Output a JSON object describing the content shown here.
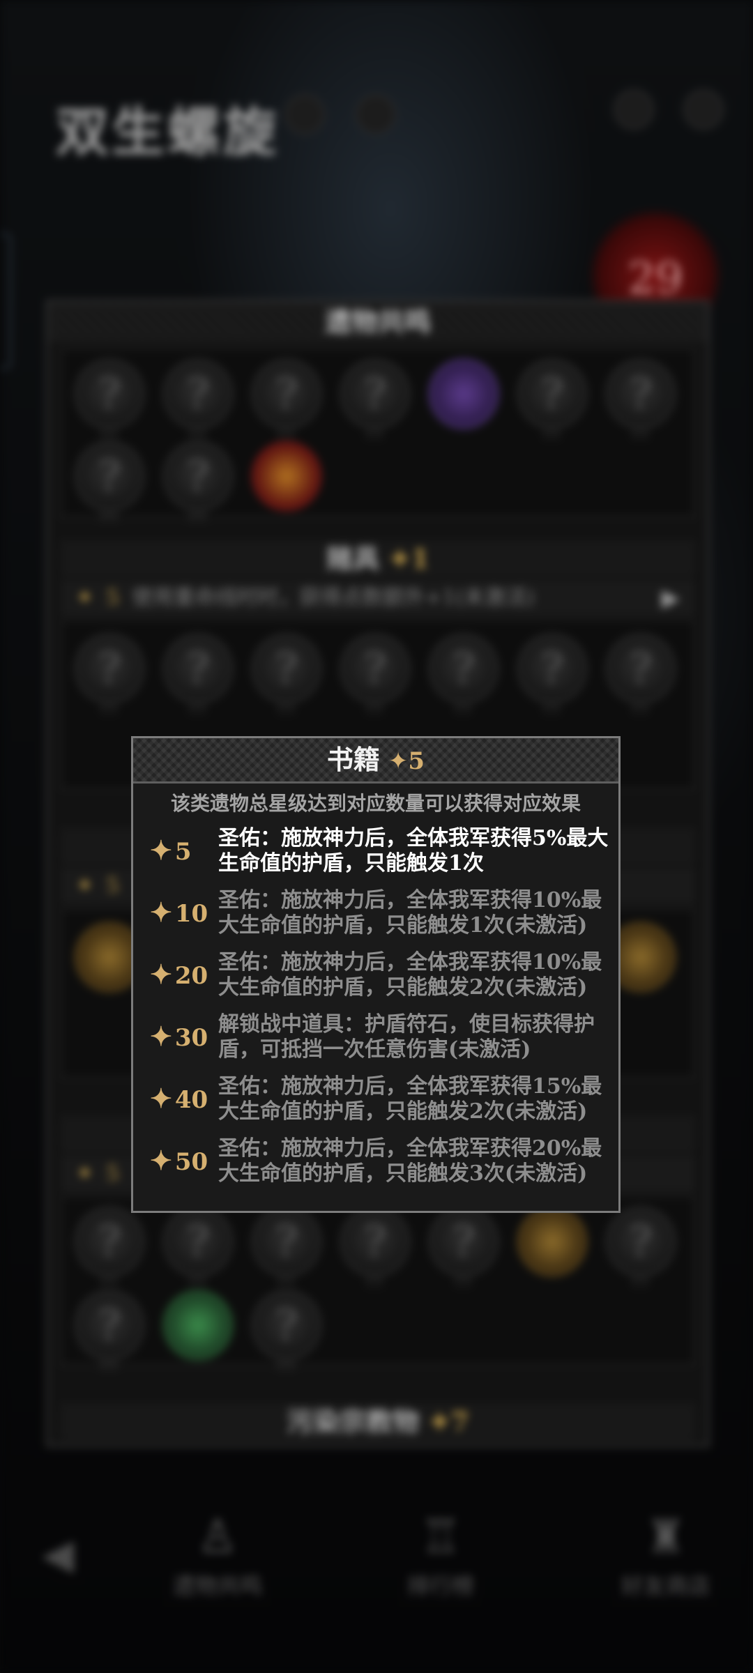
{
  "header": {
    "game_title": "双生螺旋",
    "counter_value": "29"
  },
  "panel": {
    "title": "遗物共鸣",
    "sections": [
      {
        "name": "赌具",
        "stars": "1",
        "effect_star": "5",
        "effect_text": "使用重命线时时，获得点数额外+1(未激活)",
        "arrow": "▶"
      },
      {
        "name": "污染宗教物",
        "stars": "7"
      }
    ]
  },
  "relic_placeholder": "?",
  "relic_dots": "!!!",
  "hidden_effect_star": "5",
  "bottom_nav": {
    "items": [
      {
        "label": "遗物共鸣",
        "icon": "goblet-icon"
      },
      {
        "label": "排行榜",
        "icon": "trophy-icon"
      },
      {
        "label": "好友商店",
        "icon": "shop-icon"
      }
    ]
  },
  "popup": {
    "title": "书籍",
    "title_star": "5",
    "subtitle": "该类遗物总星级达到对应数量可以获得对应效果",
    "star_glyph": "✦",
    "tiers": [
      {
        "level": "5",
        "desc": "圣佑：施放神力后，全体我军获得5%最大生命值的护盾，只能触发1次",
        "active": true
      },
      {
        "level": "10",
        "desc": "圣佑：施放神力后，全体我军获得10%最大生命值的护盾，只能触发1次(未激活)",
        "active": false
      },
      {
        "level": "20",
        "desc": "圣佑：施放神力后，全体我军获得10%最大生命值的护盾，只能触发2次(未激活)",
        "active": false
      },
      {
        "level": "30",
        "desc": "解锁战中道具：护盾符石，使目标获得护盾，可抵挡一次任意伤害(未激活)",
        "active": false
      },
      {
        "level": "40",
        "desc": "圣佑：施放神力后，全体我军获得15%最大生命值的护盾，只能触发2次(未激活)",
        "active": false
      },
      {
        "level": "50",
        "desc": "圣佑：施放神力后，全体我军获得20%最大生命值的护盾，只能触发3次(未激活)",
        "active": false
      }
    ]
  },
  "colors": {
    "gold_star": "#d6b070",
    "active_text": "#ffffff",
    "inactive_text": "#8e8e8e",
    "popup_border": "#7c7c7c"
  }
}
